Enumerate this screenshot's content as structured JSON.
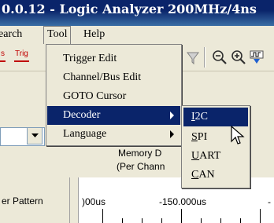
{
  "window": {
    "title": "0.0.12 - Logic Analyzer 200MHz/4ns"
  },
  "menubar": {
    "items": [
      {
        "label": "earch"
      },
      {
        "label": "Tool"
      },
      {
        "label": "Help"
      }
    ]
  },
  "toolbar": {
    "item_s": "s",
    "trig_label": "Trig",
    "icons": [
      "filter-icon",
      "zoom-out-icon",
      "zoom-in-icon",
      "signal-icon"
    ]
  },
  "tool_menu": {
    "items": [
      {
        "label": "Trigger Edit"
      },
      {
        "label": "Channel/Bus Edit"
      },
      {
        "label": "GOTO Cursor"
      },
      {
        "label": "Decoder",
        "submenu": true,
        "highlighted": true
      },
      {
        "label": "Language",
        "submenu": true
      }
    ]
  },
  "decoder_submenu": {
    "items": [
      {
        "label": "I2C",
        "highlighted": true
      },
      {
        "label": "SPI"
      },
      {
        "label": "UART"
      },
      {
        "label": "CAN"
      }
    ]
  },
  "memory": {
    "line1": "Memory D",
    "line2": "(Per Chann"
  },
  "panel": {
    "left_label": "er Pattern",
    "time1": ")00us",
    "time2": "-150.000us",
    "time3": "-"
  },
  "colors": {
    "highlight": "#0a246a",
    "trig_red": "#c00000",
    "face": "#ece9d8"
  }
}
